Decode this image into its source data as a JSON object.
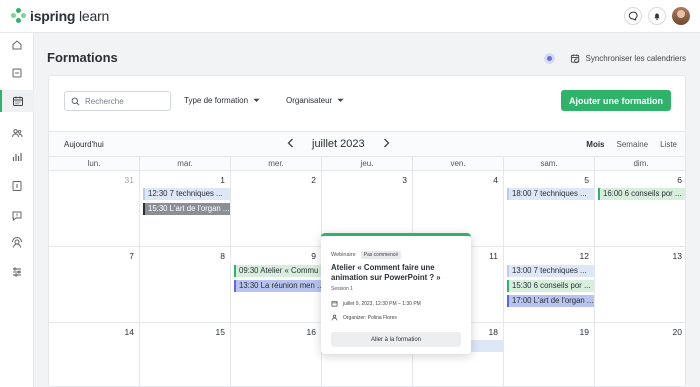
{
  "app": {
    "logo_bold": "ispring",
    "logo_light": "learn"
  },
  "header": {
    "icons": [
      "chat-icon",
      "bell-icon",
      "avatar"
    ]
  },
  "sidebar": {
    "items": [
      {
        "icon": "home-icon"
      },
      {
        "icon": "courses-icon"
      },
      {
        "icon": "calendar-icon",
        "active": true
      },
      {
        "icon": "users-icon"
      },
      {
        "icon": "reports-icon"
      },
      {
        "icon": "catalog-icon"
      },
      {
        "icon": "feedback-icon"
      },
      {
        "icon": "profile-settings-icon"
      },
      {
        "icon": "settings-sliders-icon"
      }
    ]
  },
  "page": {
    "title": "Formations",
    "sync_label": "Synchroniser les calendriers"
  },
  "filters": {
    "search_placeholder": "Recherche",
    "type_label": "Type de formation",
    "organizer_label": "Organisateur",
    "add_button": "Ajouter une formation"
  },
  "calendar": {
    "today_label": "Aujourd'hui",
    "month_label": "juillet 2023",
    "views": [
      "Mois",
      "Semaine",
      "Liste"
    ],
    "active_view": "Mois",
    "weekdays": [
      "lun.",
      "mar.",
      "mer.",
      "jeu.",
      "ven.",
      "sam.",
      "dim."
    ],
    "weeks": [
      [
        {
          "n": "31",
          "muted": true
        },
        {
          "n": "1"
        },
        {
          "n": "2"
        },
        {
          "n": "3"
        },
        {
          "n": "4"
        },
        {
          "n": "5"
        },
        {
          "n": "6"
        }
      ],
      [
        {
          "n": "7"
        },
        {
          "n": "8"
        },
        {
          "n": "9"
        },
        {
          "n": "10"
        },
        {
          "n": "11"
        },
        {
          "n": "12"
        },
        {
          "n": "13"
        }
      ],
      [
        {
          "n": "14"
        },
        {
          "n": "15"
        },
        {
          "n": "16"
        },
        {
          "n": "17"
        },
        {
          "n": "18"
        },
        {
          "n": "19"
        },
        {
          "n": "20"
        }
      ]
    ],
    "events": {
      "w0_tue_1": "12:30 7 techniques ...",
      "w0_tue_2": "15:30 L'art de l'organ ...",
      "w0_sat_1": "18:00 7 techniques ...",
      "w0_sun_1": "16:00 6 conseils por ...",
      "w1_wed_1": "09:30 Atelier « Commu ...",
      "w1_wed_2": "13:30 La réunion men ...",
      "w1_sat_1": "13:00 7 techniques ...",
      "w1_sat_2": "15:30 6 conseils por ...",
      "w1_sat_3": "17:00  L'art de l'organ ...",
      "w2_fri_1": "even ..."
    }
  },
  "popup": {
    "type": "Webinaire",
    "badge": "Pas commencé",
    "title": "Atelier « Comment faire une animation sur PowerPoint ? »",
    "session": "Session 1",
    "datetime": "juillet 9, 2023, 12:30 PM – 1:30 PM",
    "organizer": "Organizer: Polina Flores",
    "button": "Aller à la formation"
  }
}
